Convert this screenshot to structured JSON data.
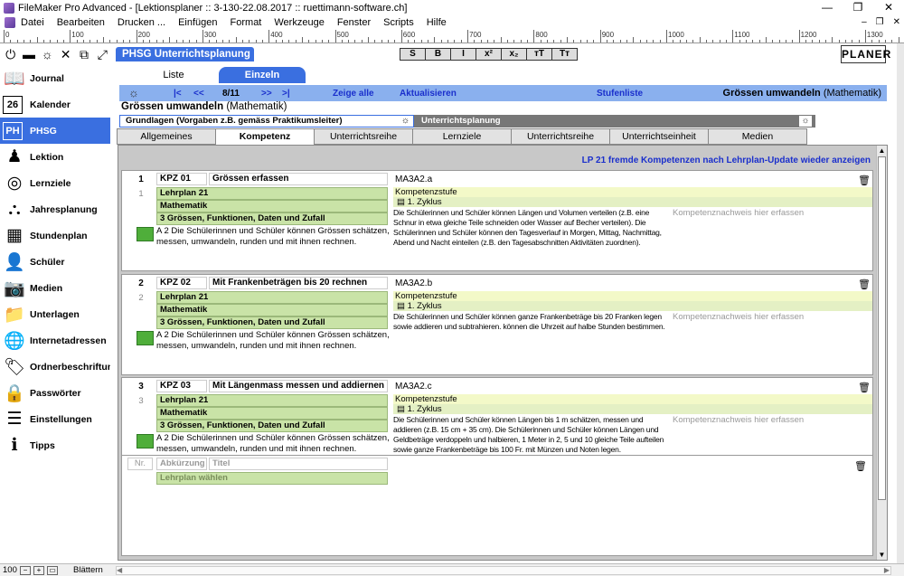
{
  "window": {
    "title": "FileMaker Pro Advanced - [Lektionsplaner :: 3-130-22.08.2017 :: ruettimann-software.ch]",
    "controls": [
      "—",
      "❐",
      "✕"
    ]
  },
  "menu": {
    "items": [
      "Datei",
      "Bearbeiten",
      "Drucken ...",
      "Einfügen",
      "Format",
      "Werkzeuge",
      "Fenster",
      "Scripts",
      "Hilfe"
    ],
    "controls": [
      "–",
      "❐",
      "✕"
    ]
  },
  "ruler": {
    "labels": [
      "0",
      "100",
      "200",
      "300",
      "400",
      "500",
      "600",
      "700",
      "800",
      "900",
      "1000",
      "1100",
      "1200",
      "1300"
    ]
  },
  "sidebar": {
    "tools": [
      {
        "icon": "power-icon",
        "glyph": "⏻"
      },
      {
        "icon": "flag-germany-icon",
        "glyph": "▬"
      },
      {
        "icon": "bulb-icon",
        "glyph": "☼"
      },
      {
        "icon": "close-icon",
        "glyph": "✕"
      },
      {
        "icon": "windows-icon",
        "glyph": "⧉"
      },
      {
        "icon": "expand-icon",
        "glyph": "⤢"
      }
    ],
    "items": [
      {
        "label": "Journal",
        "icon": "book-icon",
        "glyph": "📖"
      },
      {
        "label": "Kalender",
        "icon": "calendar-icon",
        "glyph": "26"
      },
      {
        "label": "PHSG",
        "icon": "phsg-icon",
        "glyph": "PH",
        "active": true
      },
      {
        "label": "Lektion",
        "icon": "lesson-icon",
        "glyph": "♟"
      },
      {
        "label": "Lernziele",
        "icon": "target-icon",
        "glyph": "◎"
      },
      {
        "label": "Jahresplanung",
        "icon": "hierarchy-icon",
        "glyph": "⛬"
      },
      {
        "label": "Stundenplan",
        "icon": "grid-icon",
        "glyph": "▦"
      },
      {
        "label": "Schüler",
        "icon": "student-icon",
        "glyph": "👤"
      },
      {
        "label": "Medien",
        "icon": "camera-icon",
        "glyph": "📷"
      },
      {
        "label": "Unterlagen",
        "icon": "folder-icon",
        "glyph": "📁"
      },
      {
        "label": "Internetadressen",
        "icon": "globe-icon",
        "glyph": "🌐"
      },
      {
        "label": "Ordnerbeschriftung",
        "icon": "tag-icon",
        "glyph": "🏷"
      },
      {
        "label": "Passwörter",
        "icon": "lock-icon",
        "glyph": "🔒"
      },
      {
        "label": "Einstellungen",
        "icon": "sliders-icon",
        "glyph": "☰"
      },
      {
        "label": "Tipps",
        "icon": "info-book-icon",
        "glyph": "ℹ"
      }
    ]
  },
  "header": {
    "title": "PHSG Unterrichtsplanung",
    "format_buttons": [
      "S",
      "B",
      "I",
      "x²",
      "x₂",
      "тT",
      "Tт"
    ],
    "logo": "PLANER"
  },
  "view_tabs": {
    "liste": "Liste",
    "einzeln": "Einzeln"
  },
  "navbar": {
    "first": "|<",
    "prev": "<<",
    "counter": "8/11",
    "next": ">>",
    "last": ">|",
    "show_all": "Zeige alle",
    "refresh": "Aktualisieren",
    "level_list": "Stufenliste",
    "title": "Grössen umwandeln",
    "subject": "(Mathematik)"
  },
  "section": {
    "title": "Grössen umwandeln",
    "subject": "(Mathematik)"
  },
  "group_tabs": {
    "a": "Grundlagen (Vorgaben z.B. gemäss Praktikumsleiter)",
    "b": "Unterrichtsplanung"
  },
  "subtabs": [
    "Allgemeines",
    "Kompetenz",
    "Unterrichtsreihe",
    "Lernziele",
    "Unterrichtsreihe",
    "Unterrichtseinheit",
    "Medien"
  ],
  "lp_link": "LP 21 fremde Kompetenzen nach Lehrplan-Update wieder anzeigen",
  "records": [
    {
      "num": "1",
      "abbr": "KPZ 01",
      "title": "Grössen erfassen",
      "code": "MA3A2.a",
      "idx": "1",
      "lehrplan": "Lehrplan 21",
      "fach": "Mathematik",
      "bereich": "3 Grössen, Funktionen, Daten und Zufall",
      "adesc": "A 2 Die Schülerinnen und Schüler können Grössen schätzen, messen, umwandeln, runden und mit ihnen rechnen.",
      "kstufe": "Kompetenzstufe",
      "zyklus": "1. Zyklus",
      "kdesc": "Die Schülerinnen und Schüler können Längen und Volumen verteilen (z.B. eine Schnur in etwa gleiche Teile schneiden oder Wasser auf Becher verteilen). Die Schülerinnen und Schüler können den Tagesverlauf in Morgen, Mittag, Nachmittag, Abend und Nacht einteilen (z.B. den Tagesabschnitten Aktivitäten zuordnen).",
      "knw": "Kompetenznachweis hier erfassen"
    },
    {
      "num": "2",
      "abbr": "KPZ 02",
      "title": "Mit Frankenbeträgen bis 20 rechnen",
      "code": "MA3A2.b",
      "idx": "2",
      "lehrplan": "Lehrplan 21",
      "fach": "Mathematik",
      "bereich": "3 Grössen, Funktionen, Daten und Zufall",
      "adesc": "A 2 Die Schülerinnen und Schüler können Grössen schätzen, messen, umwandeln, runden und mit ihnen rechnen.",
      "kstufe": "Kompetenzstufe",
      "zyklus": "1. Zyklus",
      "kdesc": "Die Schülerinnen und Schüler können ganze Frankenbeträge bis 20 Franken legen sowie addieren und subtrahieren. können die Uhrzeit auf halbe Stunden bestimmen.",
      "knw": "Kompetenznachweis hier erfassen"
    },
    {
      "num": "3",
      "abbr": "KPZ 03",
      "title": "Mit Längenmass messen und addiernen",
      "code": "MA3A2.c",
      "idx": "3",
      "lehrplan": "Lehrplan 21",
      "fach": "Mathematik",
      "bereich": "3 Grössen, Funktionen, Daten und Zufall",
      "adesc": "A 2 Die Schülerinnen und Schüler können Grössen schätzen, messen, umwandeln, runden und mit ihnen rechnen.",
      "kstufe": "Kompetenzstufe",
      "zyklus": "1. Zyklus",
      "kdesc": "Die Schülerinnen und Schüler können Längen bis 1 m schätzen, messen und addieren (z.B. 15 cm + 35 cm). Die Schülerinnen und Schüler können Längen und Geldbeträge verdoppeln und halbieren, 1 Meter in 2, 5 und 10 gleiche Teile aufteilen sowie ganze Frankenbeträge bis 100 Fr. mit Münzen und Noten legen.",
      "knw": "Kompetenznachweis hier erfassen"
    }
  ],
  "new_record": {
    "nr": "Nr.",
    "abbr": "Abkürzung",
    "title": "Titel",
    "lehrplan": "Lehrplan wählen"
  },
  "status": {
    "zoom": "100",
    "mode": "Blättern"
  },
  "colors": {
    "accent": "#3a6fe0",
    "nav": "#8ab0ee",
    "green": "#c9e3a7",
    "link": "#1a2fcc"
  }
}
